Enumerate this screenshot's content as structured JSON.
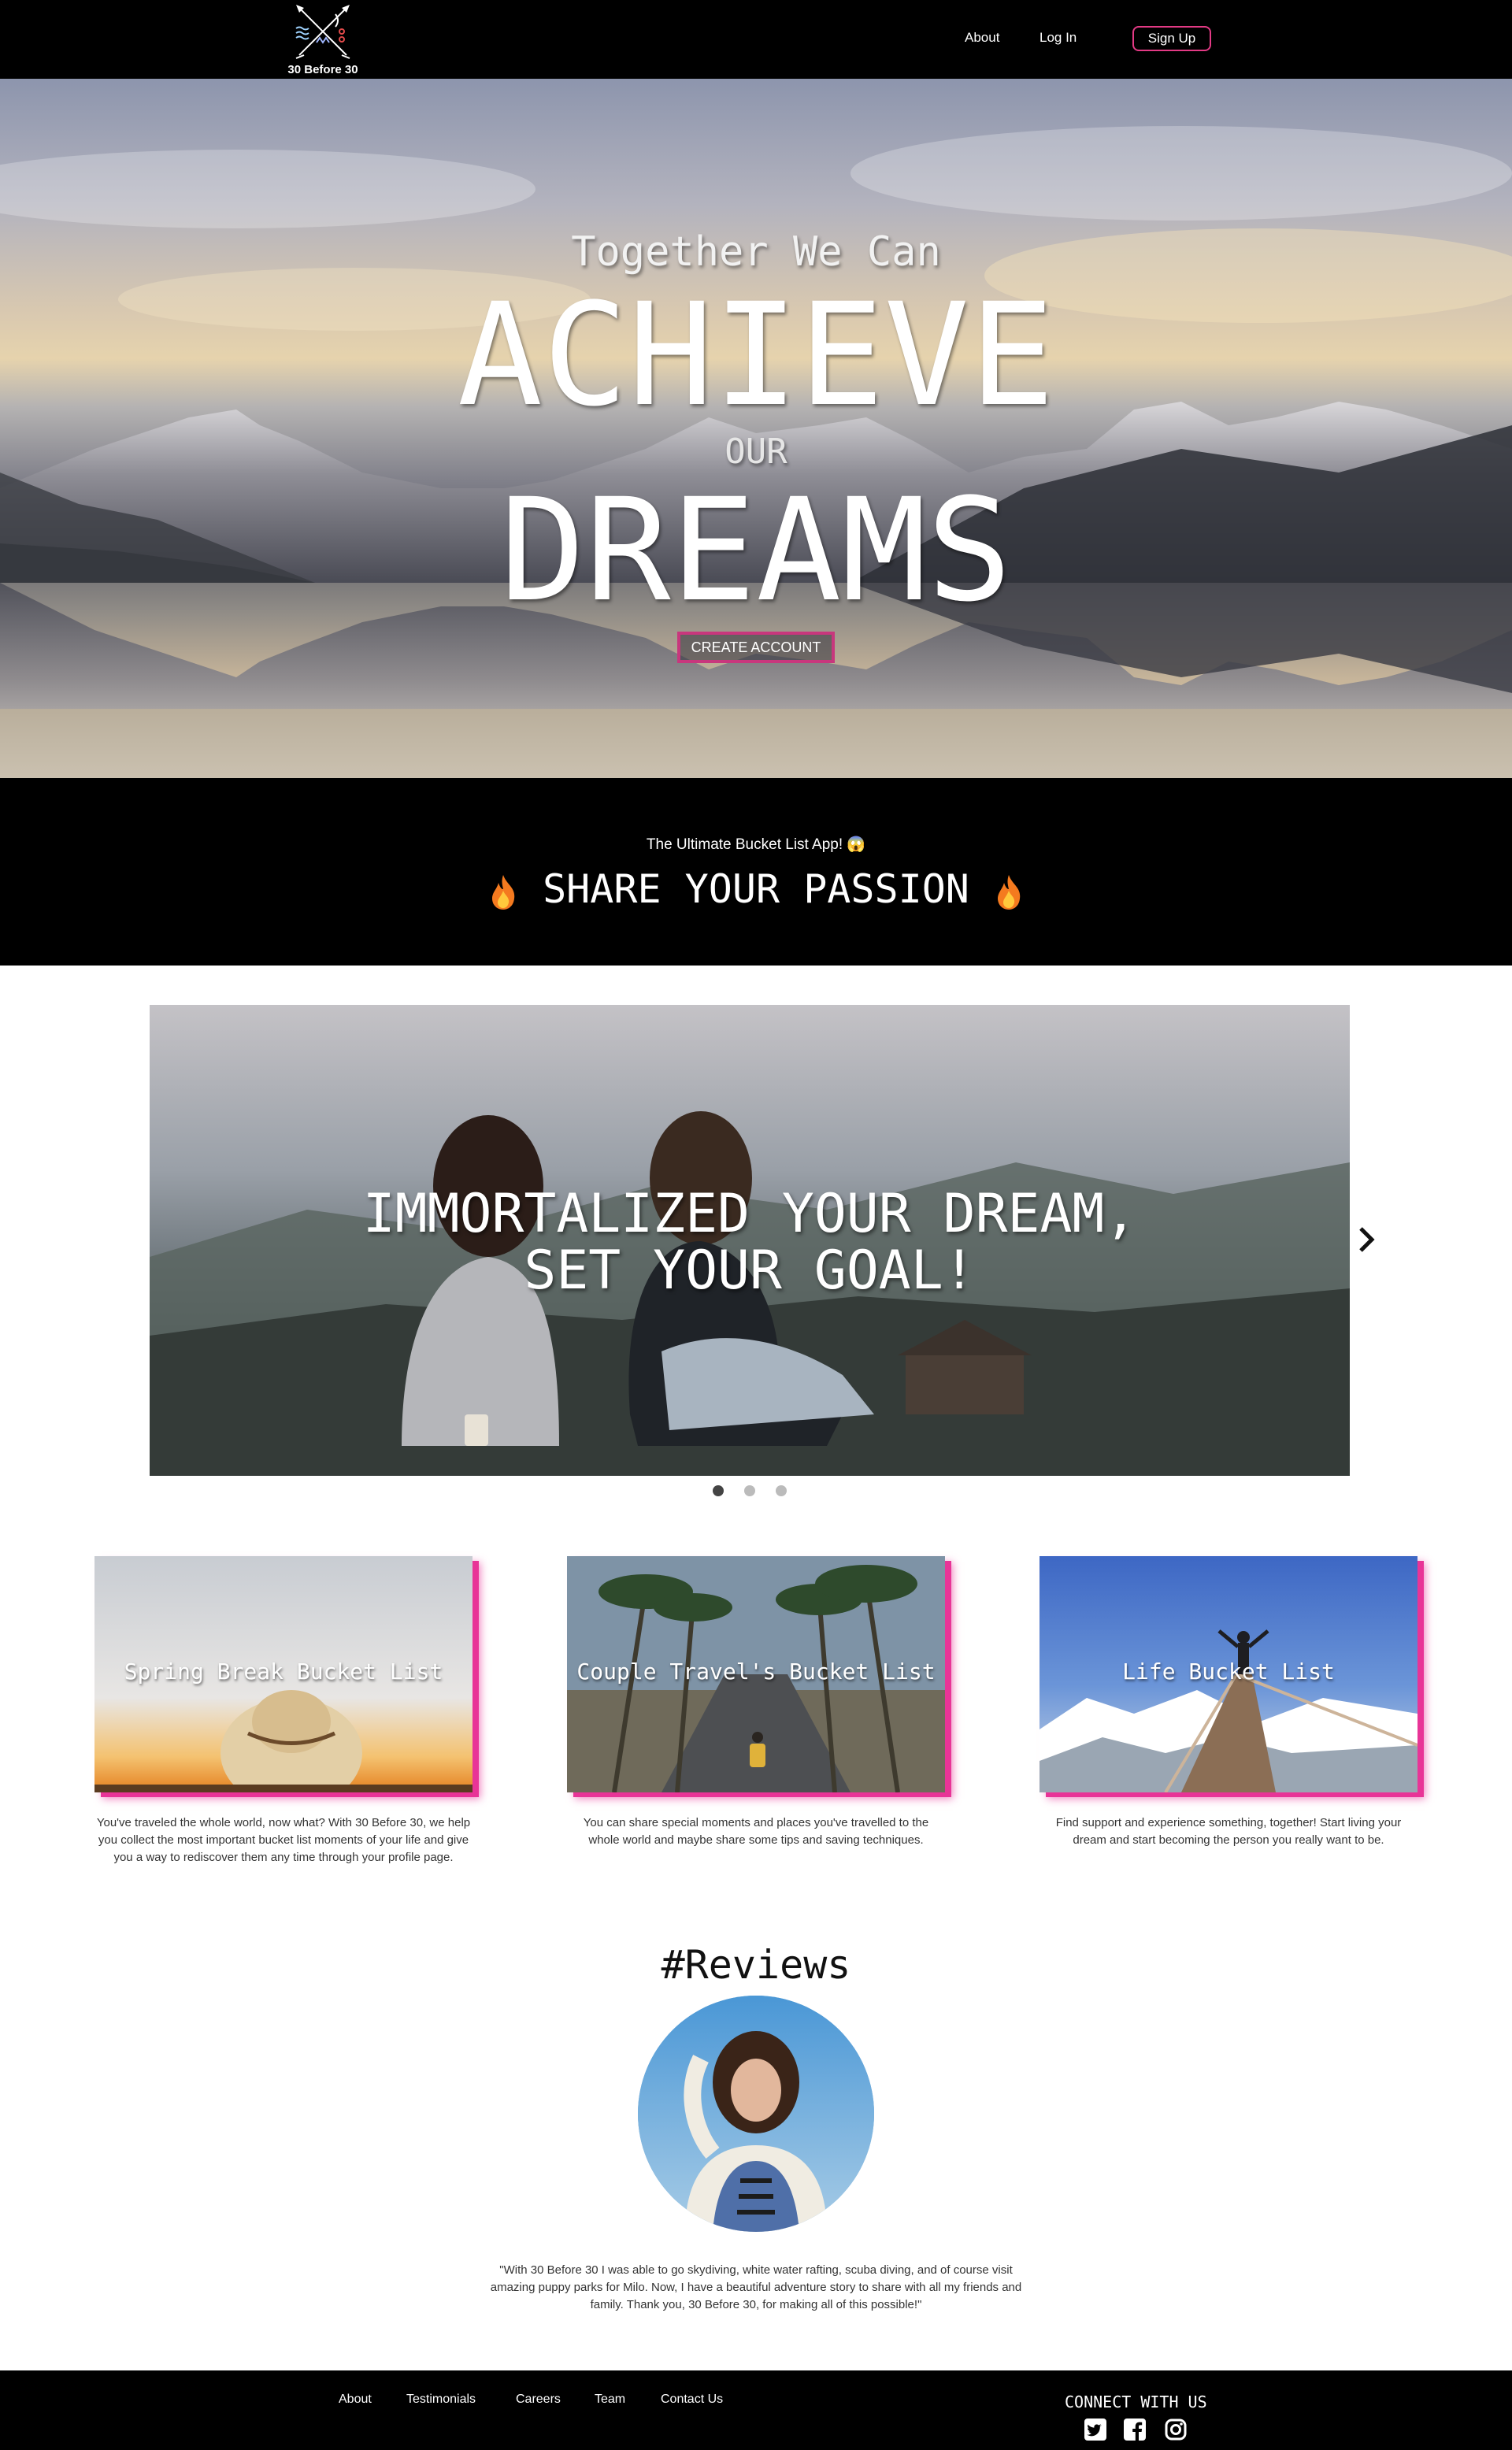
{
  "nav": {
    "logo_text": "30 Before 30",
    "about": "About",
    "login": "Log In",
    "signup": "Sign Up"
  },
  "hero": {
    "line1": "Together We Can",
    "line2": "ACHIEVE",
    "line3": "OUR",
    "line4": "DREAMS",
    "cta": "CREATE ACCOUNT"
  },
  "passion": {
    "subtitle": "The Ultimate Bucket List App! 😱",
    "title": "SHARE YOUR PASSION",
    "icons": [
      "fire-icon",
      "fire-icon"
    ]
  },
  "carousel": {
    "line1": "IMMORTALIZED YOUR DREAM,",
    "line2": "SET YOUR GOAL!",
    "active_slide": 1,
    "slide_count": 3,
    "next_icon": "chevron-right-icon"
  },
  "cards": [
    {
      "title": "Spring Break Bucket List",
      "description": "You've traveled the whole world, now what? With 30 Before 30, we help you collect the most important bucket list moments of your life and give you a way to rediscover them any time through your profile page."
    },
    {
      "title": "Couple Travel's Bucket List",
      "description": "You can share special moments and places you've travelled to the whole world and maybe share some tips and saving techniques."
    },
    {
      "title": "Life Bucket List",
      "description": "Find support and experience something, together! Start living your dream and start becoming the person you really want to be."
    }
  ],
  "reviews": {
    "title": "#Reviews",
    "quote": "\"With 30 Before 30 I was able to go skydiving, white water rafting, scuba diving, and of course visit amazing puppy parks for Milo. Now, I have a beautiful adventure story to share with all my friends and family. Thank you, 30 Before 30, for making all of this possible!\""
  },
  "footer": {
    "links": [
      "About",
      "Testimonials",
      "Careers",
      "Team",
      "Contact Us"
    ],
    "connect": "CONNECT WITH US",
    "social_icons": [
      "twitter-icon",
      "facebook-icon",
      "instagram-icon"
    ]
  },
  "colors": {
    "accent": "#e83497",
    "nav_bg": "#000000",
    "button_border": "#c8377d"
  }
}
